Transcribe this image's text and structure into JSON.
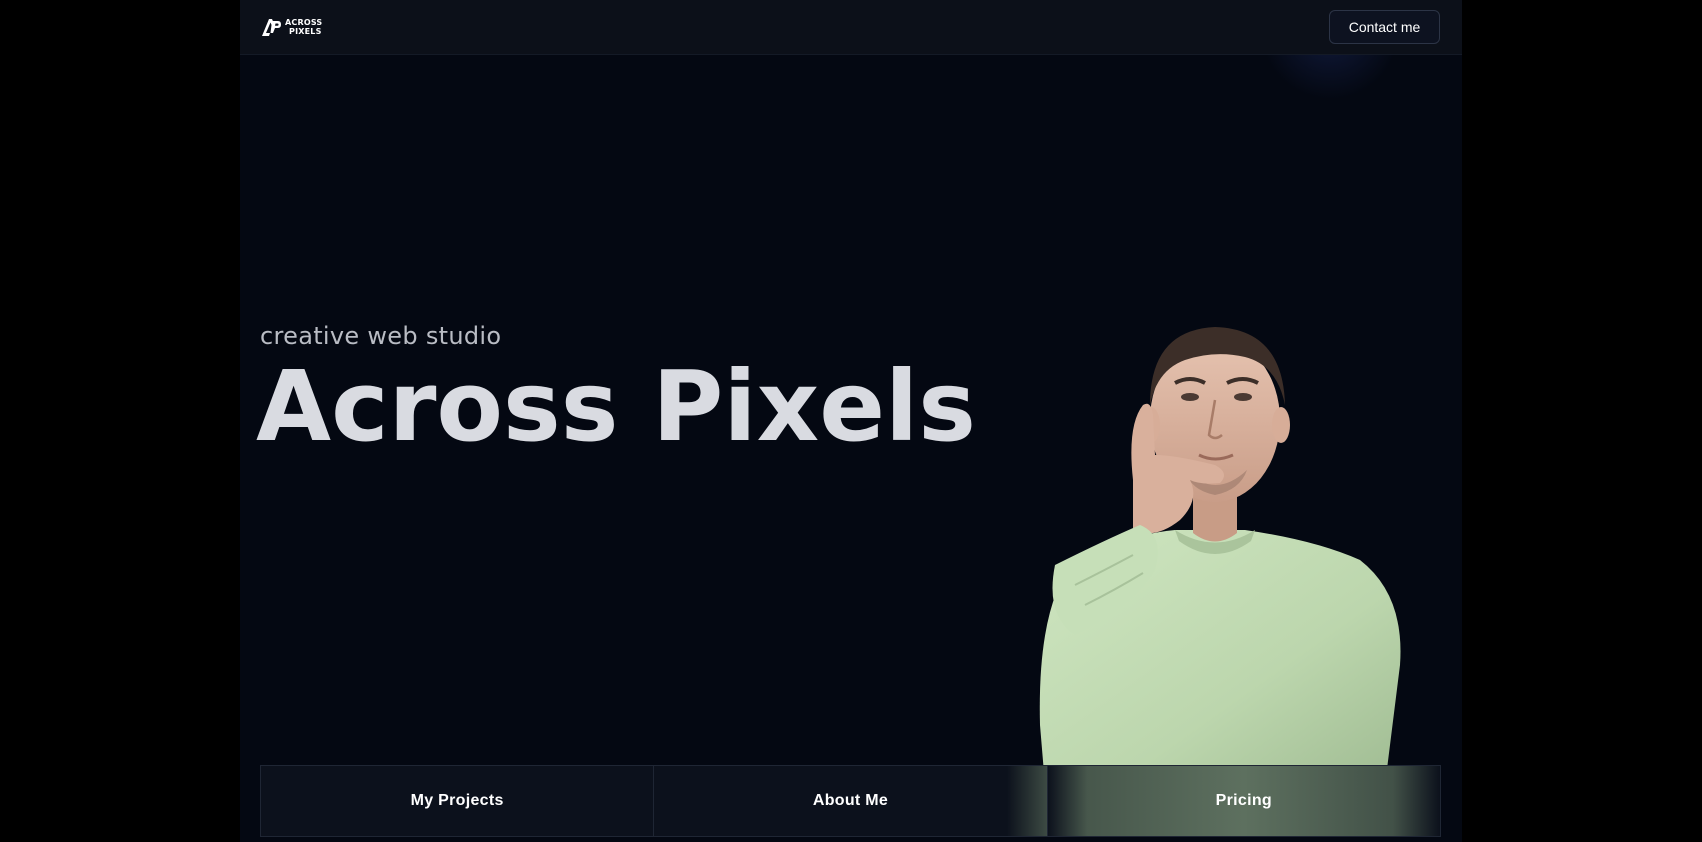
{
  "header": {
    "logo": {
      "line1": "ACROSS",
      "line2": "PIXELS"
    },
    "contact_label": "Contact me"
  },
  "hero": {
    "subtitle": "creative web studio",
    "title": "Across Pixels"
  },
  "bottom_nav": {
    "items": [
      {
        "label": "My Projects"
      },
      {
        "label": "About Me"
      },
      {
        "label": "Pricing"
      }
    ]
  },
  "colors": {
    "page_background": "#000000",
    "frame_background": "#040812",
    "header_background": "#0c1019",
    "title_color": "#d9dbe1",
    "shirt_color": "#c3dcb6"
  }
}
